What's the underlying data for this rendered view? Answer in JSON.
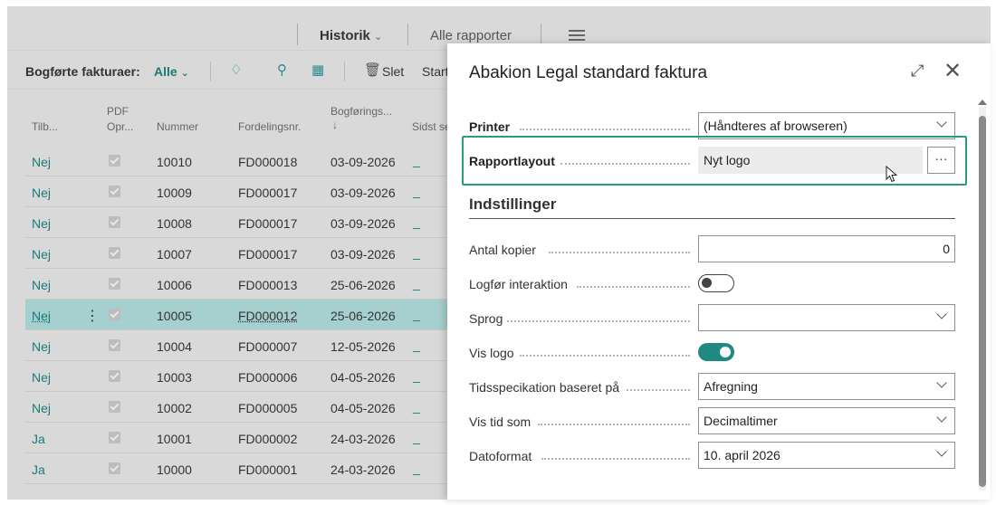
{
  "topnav": {
    "history": "Historik",
    "all_reports": "Alle rapporter"
  },
  "actionbar": {
    "caption": "Bogførte fakturaer:",
    "filter": "Alle",
    "delete": "Slet",
    "start": "Start"
  },
  "table": {
    "headers": {
      "c1": "Tilb...",
      "c2a": "PDF",
      "c2b": "Opr...",
      "c3": "Nummer",
      "c4": "Fordelingsnr.",
      "c5a": "Bogførings...",
      "c5b": "↓",
      "c6": "Sidst se"
    },
    "rows": [
      {
        "tilb": "Nej",
        "nummer": "10010",
        "fordeling": "FD000018",
        "dato": "03-09-2026",
        "last": "_"
      },
      {
        "tilb": "Nej",
        "nummer": "10009",
        "fordeling": "FD000017",
        "dato": "03-09-2026",
        "last": "_"
      },
      {
        "tilb": "Nej",
        "nummer": "10008",
        "fordeling": "FD000017",
        "dato": "03-09-2026",
        "last": "_"
      },
      {
        "tilb": "Nej",
        "nummer": "10007",
        "fordeling": "FD000017",
        "dato": "03-09-2026",
        "last": "_"
      },
      {
        "tilb": "Nej",
        "nummer": "10006",
        "fordeling": "FD000013",
        "dato": "25-06-2026",
        "last": "_"
      },
      {
        "tilb": "Nej",
        "nummer": "10005",
        "fordeling": "FD000012",
        "dato": "25-06-2026",
        "last": "_"
      },
      {
        "tilb": "Nej",
        "nummer": "10004",
        "fordeling": "FD000007",
        "dato": "12-05-2026",
        "last": "_"
      },
      {
        "tilb": "Nej",
        "nummer": "10003",
        "fordeling": "FD000006",
        "dato": "04-05-2026",
        "last": "_"
      },
      {
        "tilb": "Nej",
        "nummer": "10002",
        "fordeling": "FD000005",
        "dato": "04-05-2026",
        "last": "_"
      },
      {
        "tilb": "Ja",
        "nummer": "10001",
        "fordeling": "FD000002",
        "dato": "24-03-2026",
        "last": "_"
      },
      {
        "tilb": "Ja",
        "nummer": "10000",
        "fordeling": "FD000001",
        "dato": "24-03-2026",
        "last": "_"
      }
    ]
  },
  "dialog": {
    "title": "Abakion Legal standard faktura",
    "printer_label": "Printer",
    "printer_value": "(Håndteres af browseren)",
    "layout_label": "Rapportlayout",
    "layout_value": "Nyt logo",
    "more": "···",
    "section": "Indstillinger",
    "copies_label": "Antal kopier",
    "copies_value": "0",
    "log_label": "Logfør interaktion",
    "language_label": "Sprog",
    "language_value": "",
    "logo_label": "Vis logo",
    "timespec_label": "Tidsspecikation baseret på",
    "timespec_value": "Afregning",
    "showtime_label": "Vis tid som",
    "showtime_value": "Decimaltimer",
    "dateformat_label": "Datoformat",
    "dateformat_value": "10. april 2026"
  },
  "colors": {
    "accent": "#1a7a7a",
    "toggle_on": "#1e8a82",
    "highlight": "#2a9d78",
    "selected_row": "#a6cfcf"
  }
}
